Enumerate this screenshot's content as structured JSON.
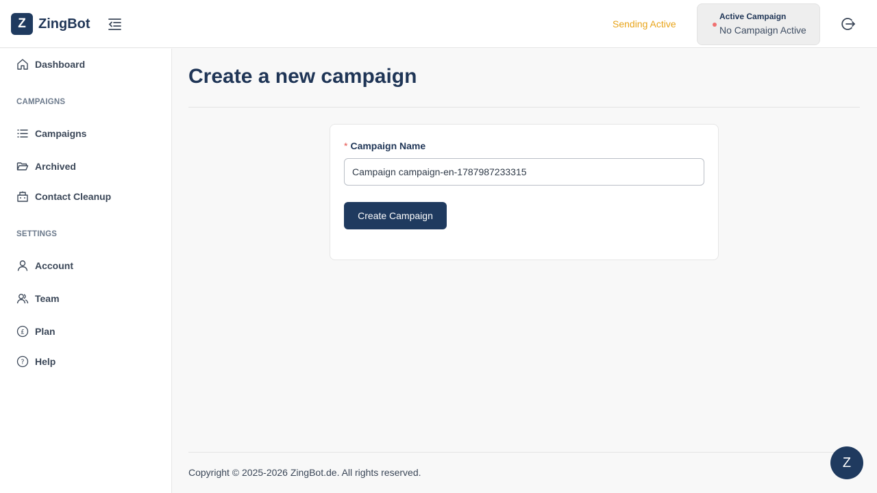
{
  "header": {
    "logo_letter": "Z",
    "app_name": "ZingBot",
    "sending_status": "Sending Active",
    "active_campaign_title": "Active Campaign",
    "active_campaign_value": "No Campaign Active"
  },
  "sidebar": {
    "dashboard": "Dashboard",
    "campaigns_section": "CAMPAIGNS",
    "campaigns": "Campaigns",
    "archived": "Archived",
    "contact_cleanup": "Contact Cleanup",
    "settings_section": "SETTINGS",
    "account": "Account",
    "team": "Team",
    "plan": "Plan",
    "help": "Help"
  },
  "main": {
    "page_title": "Create a new campaign",
    "form": {
      "required_marker": "*",
      "campaign_name_label": "Campaign Name",
      "campaign_name_value": "Campaign campaign-en-1787987233315",
      "submit_label": "Create Campaign"
    }
  },
  "footer": {
    "copyright": "Copyright © 2025-2026 ZingBot.de. All rights reserved."
  },
  "chat": {
    "letter": "Z"
  },
  "icons": {
    "collapse": "collapse-sidebar-icon",
    "logout": "logout-icon",
    "dashboard": "home-icon",
    "campaigns": "list-icon",
    "archived": "folder-open-icon",
    "contact_cleanup": "building-icon",
    "account": "user-icon",
    "team": "users-icon",
    "plan": "pound-icon",
    "help": "help-circle-icon"
  },
  "colors": {
    "brand": "#1f3a5f",
    "sending_status": "#e8a317",
    "inactive_dot": "#f07070",
    "required": "#e5554f"
  }
}
